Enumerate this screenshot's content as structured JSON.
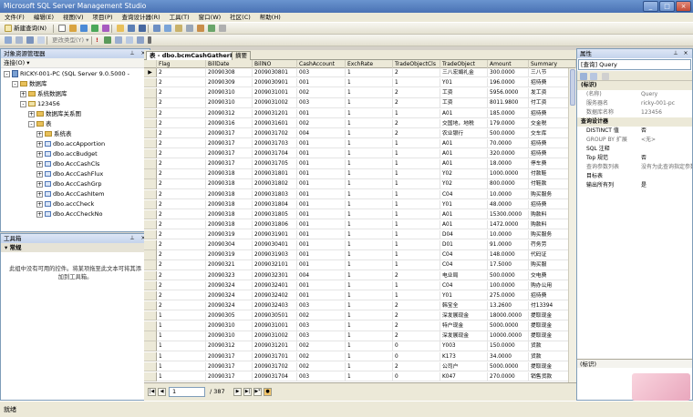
{
  "window": {
    "title": "Microsoft SQL Server Management Studio",
    "min": "_",
    "max": "□",
    "close": "×"
  },
  "menu": [
    "文件(F)",
    "编辑(E)",
    "视图(V)",
    "项目(P)",
    "查询设计器(R)",
    "工具(T)",
    "窗口(W)",
    "社区(C)",
    "帮助(H)"
  ],
  "toolbar": {
    "new_query": "新建查询(N)",
    "change_type": "更改类型(Y) ▾"
  },
  "object_explorer": {
    "title": "对象资源管理器",
    "connect": "连接(O) ▾",
    "items": [
      {
        "label": "RICKY-001-PC (SQL Server 9.0.5000 - ",
        "exp": "-",
        "icon": "server",
        "level": 0
      },
      {
        "label": "数据库",
        "exp": "-",
        "icon": "folder",
        "level": 1
      },
      {
        "label": "系统数据库",
        "exp": "+",
        "icon": "folder",
        "level": 2
      },
      {
        "label": "123456",
        "exp": "-",
        "icon": "db",
        "level": 2
      },
      {
        "label": "数据库关系图",
        "exp": "+",
        "icon": "folder",
        "level": 3
      },
      {
        "label": "表",
        "exp": "-",
        "icon": "folder",
        "level": 3
      },
      {
        "label": "系统表",
        "exp": "+",
        "icon": "folder",
        "level": 4
      },
      {
        "label": "dbo.accApportion",
        "exp": "+",
        "icon": "table",
        "level": 4
      },
      {
        "label": "dbo.accBudget",
        "exp": "+",
        "icon": "table",
        "level": 4
      },
      {
        "label": "dbo.AccCashCls",
        "exp": "+",
        "icon": "table",
        "level": 4
      },
      {
        "label": "dbo.AccCashFlux",
        "exp": "+",
        "icon": "table",
        "level": 4
      },
      {
        "label": "dbo.AccCashGrp",
        "exp": "+",
        "icon": "table",
        "level": 4
      },
      {
        "label": "dbo.AccCashItem",
        "exp": "+",
        "icon": "table",
        "level": 4
      },
      {
        "label": "dbo.accCheck",
        "exp": "+",
        "icon": "table",
        "level": 4
      },
      {
        "label": "dbo.AccCheckNo",
        "exp": "+",
        "icon": "table",
        "level": 4
      }
    ]
  },
  "toolbox": {
    "title": "工具箱",
    "section": "常规",
    "empty_text": "此组中没有可用的控件。将某项拖至此文本可将其添加到工具箱。"
  },
  "editor": {
    "tab_title": "表 - dbo.bcmCashGatherPay",
    "tab_summary": "摘要",
    "columns": [
      "Flag",
      "BillDate",
      "BillNO",
      "CashAccount",
      "ExchRate",
      "TradeObjectCls",
      "TradeObject",
      "Amount",
      "Summary"
    ],
    "rows": [
      [
        "2",
        "20090308",
        "2009030801",
        "003",
        "1",
        "2",
        "三八宏娟礼金",
        "300.0000",
        "三八节"
      ],
      [
        "2",
        "20090309",
        "2009030901",
        "001",
        "1",
        "1",
        "Y01",
        "196.0000",
        "招待费"
      ],
      [
        "2",
        "20090310",
        "2009031001",
        "002",
        "1",
        "2",
        "工资",
        "5956.0000",
        "发工资"
      ],
      [
        "2",
        "20090310",
        "2009031002",
        "003",
        "1",
        "2",
        "工资",
        "8011.9800",
        "付工资"
      ],
      [
        "2",
        "20090312",
        "2009031201",
        "001",
        "1",
        "1",
        "A01",
        "185.0000",
        "招待费"
      ],
      [
        "2",
        "20090316",
        "2009031601",
        "002",
        "1",
        "2",
        "交国地，地税",
        "179.0000",
        "交金税"
      ],
      [
        "2",
        "20090317",
        "2009031702",
        "004",
        "1",
        "2",
        "农业银行",
        "500.0000",
        "交车库"
      ],
      [
        "2",
        "20090317",
        "2009031703",
        "001",
        "1",
        "1",
        "A01",
        "70.0000",
        "招待费"
      ],
      [
        "2",
        "20090317",
        "2009031704",
        "001",
        "1",
        "1",
        "A01",
        "320.0000",
        "招待费"
      ],
      [
        "2",
        "20090317",
        "2009031705",
        "001",
        "1",
        "1",
        "A01",
        "18.0000",
        "停车费"
      ],
      [
        "2",
        "20090318",
        "2009031801",
        "001",
        "1",
        "1",
        "Y02",
        "1000.0000",
        "付款鞋"
      ],
      [
        "2",
        "20090318",
        "2009031802",
        "001",
        "1",
        "1",
        "Y02",
        "800.0000",
        "付鞋款"
      ],
      [
        "2",
        "20090318",
        "2009031803",
        "001",
        "1",
        "1",
        "C04",
        "10.0000",
        "购买服务"
      ],
      [
        "2",
        "20090318",
        "2009031804",
        "001",
        "1",
        "1",
        "Y01",
        "48.0000",
        "招待费"
      ],
      [
        "2",
        "20090318",
        "2009031805",
        "001",
        "1",
        "1",
        "A01",
        "15300.0000",
        "购款料"
      ],
      [
        "2",
        "20090318",
        "2009031806",
        "001",
        "1",
        "1",
        "A01",
        "1472.0000",
        "购款料"
      ],
      [
        "2",
        "20090319",
        "2009031901",
        "001",
        "1",
        "1",
        "D04",
        "10.0000",
        "购买服务"
      ],
      [
        "2",
        "20090304",
        "2009030401",
        "001",
        "1",
        "1",
        "D01",
        "91.0000",
        "荇务劳"
      ],
      [
        "2",
        "20090319",
        "2009031903",
        "001",
        "1",
        "1",
        "C04",
        "148.0000",
        "代码证"
      ],
      [
        "2",
        "20090321",
        "2009032101",
        "001",
        "1",
        "1",
        "C04",
        "17.5000",
        "购买服"
      ],
      [
        "2",
        "20090323",
        "2009032301",
        "004",
        "1",
        "2",
        "电业局",
        "500.0000",
        "交电费"
      ],
      [
        "2",
        "20090324",
        "2009032401",
        "001",
        "1",
        "1",
        "C04",
        "100.0000",
        "购办公用"
      ],
      [
        "2",
        "20090324",
        "2009032402",
        "001",
        "1",
        "1",
        "Y01",
        "275.0000",
        "招待费"
      ],
      [
        "2",
        "20090324",
        "2009032403",
        "003",
        "1",
        "2",
        "韩宝全",
        "13.2600",
        "付13394"
      ],
      [
        "1",
        "20090305",
        "2009030501",
        "002",
        "1",
        "2",
        "深发展现金",
        "18000.0000",
        "提取现金"
      ],
      [
        "1",
        "20090310",
        "2009031001",
        "003",
        "1",
        "2",
        "特户现金",
        "5000.0000",
        "提取现金"
      ],
      [
        "1",
        "20090310",
        "2009031002",
        "003",
        "1",
        "2",
        "深发展现金",
        "10000.0000",
        "提取现金"
      ],
      [
        "1",
        "20090312",
        "2009031201",
        "002",
        "1",
        "0",
        "Y003",
        "150.0000",
        "货款"
      ],
      [
        "1",
        "20090317",
        "2009031701",
        "002",
        "1",
        "0",
        "K173",
        "34.0000",
        "货款"
      ],
      [
        "1",
        "20090317",
        "2009031702",
        "002",
        "1",
        "2",
        "公司户",
        "5000.0000",
        "提取现金"
      ],
      [
        "1",
        "20090317",
        "2009031704",
        "003",
        "1",
        "0",
        "K047",
        "270.0000",
        "销售货款"
      ]
    ],
    "nav": {
      "page": "1",
      "total": "/ 387"
    }
  },
  "properties": {
    "title": "属性",
    "object": "[查询] Query",
    "rows": [
      {
        "cat": true,
        "name": "(标识)",
        "value": ""
      },
      {
        "name": "(名称)",
        "value": "Query"
      },
      {
        "name": "服务器名",
        "value": "ricky-001-pc"
      },
      {
        "name": "数据库名称",
        "value": "123456"
      },
      {
        "cat": true,
        "name": "查询设计器",
        "value": ""
      },
      {
        "name": "DISTINCT 值",
        "value": "否"
      },
      {
        "name": "GROUP BY 扩展",
        "value": "<无>"
      },
      {
        "name": "SQL 注释",
        "value": ""
      },
      {
        "name": "Top 规范",
        "value": "否"
      },
      {
        "name": "查询参数列表",
        "value": "没有为此查询指定参数"
      },
      {
        "name": "目标表",
        "value": ""
      },
      {
        "name": "输出所有列",
        "value": "是"
      }
    ],
    "footer": "(标识)"
  },
  "status": {
    "text": "就绪"
  }
}
